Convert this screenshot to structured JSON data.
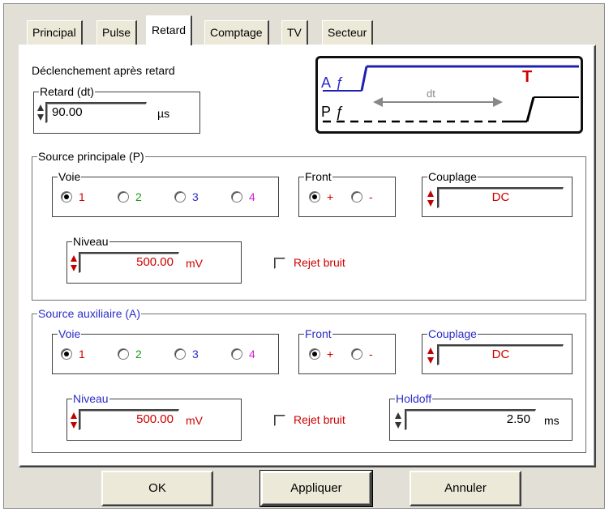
{
  "tabs": [
    {
      "label": "Principal"
    },
    {
      "label": "Pulse"
    },
    {
      "label": "Retard"
    },
    {
      "label": "Comptage"
    },
    {
      "label": "TV"
    },
    {
      "label": "Secteur"
    }
  ],
  "page": {
    "heading": "Déclenchement après retard",
    "delay": {
      "legend": "Retard (dt)",
      "value": "90.00",
      "unit": "µs"
    },
    "diagram": {
      "a_label": "A",
      "p_label": "P",
      "dt_label": "dt",
      "t_label": "T",
      "edge_glyph": "ƒ"
    }
  },
  "principal": {
    "legend": "Source principale (P)",
    "voie": {
      "legend": "Voie",
      "options": [
        "1",
        "2",
        "3",
        "4"
      ],
      "selected": "1"
    },
    "front": {
      "legend": "Front",
      "plus": "+",
      "minus": "-",
      "selected": "+"
    },
    "couplage": {
      "legend": "Couplage",
      "value": "DC"
    },
    "niveau": {
      "legend": "Niveau",
      "value": "500.00",
      "unit": "mV"
    },
    "rejet": {
      "label": "Rejet bruit",
      "checked": false
    }
  },
  "auxiliaire": {
    "legend": "Source auxiliaire (A)",
    "voie": {
      "legend": "Voie",
      "options": [
        "1",
        "2",
        "3",
        "4"
      ],
      "selected": "1"
    },
    "front": {
      "legend": "Front",
      "plus": "+",
      "minus": "-",
      "selected": "+"
    },
    "couplage": {
      "legend": "Couplage",
      "value": "DC"
    },
    "niveau": {
      "legend": "Niveau",
      "value": "500.00",
      "unit": "mV"
    },
    "rejet": {
      "label": "Rejet bruit",
      "checked": false
    },
    "holdoff": {
      "legend": "Holdoff",
      "value": "2.50",
      "unit": "ms"
    }
  },
  "buttons": {
    "ok": "OK",
    "apply": "Appliquer",
    "cancel": "Annuler"
  },
  "colors": {
    "red": "#d00000",
    "blue": "#2b2bc8",
    "green": "#1a9a1a",
    "magenta": "#d020d0"
  }
}
